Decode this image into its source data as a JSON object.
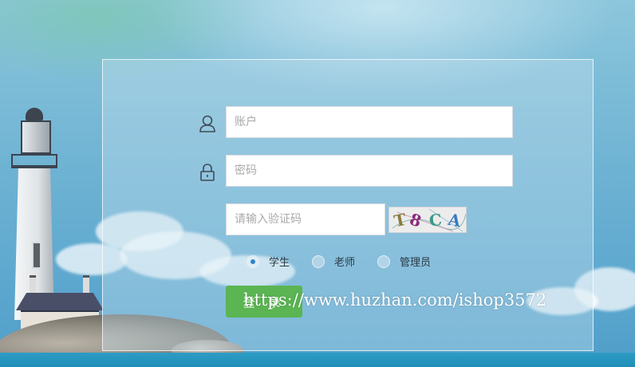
{
  "form": {
    "username": {
      "placeholder": "账户",
      "icon": "user-icon"
    },
    "password": {
      "placeholder": "密码",
      "icon": "lock-icon"
    },
    "captcha_input": {
      "placeholder": "请输入验证码"
    },
    "captcha_image": {
      "text": [
        "T",
        "8",
        "C",
        "A"
      ],
      "colors": [
        "#8a7b3a",
        "#8a2a7a",
        "#3a9a8a",
        "#3a7ac0"
      ]
    },
    "roles": [
      {
        "label": "学生",
        "selected": true
      },
      {
        "label": "老师",
        "selected": false
      },
      {
        "label": "管理员",
        "selected": false
      }
    ],
    "login_label": "登 录"
  },
  "watermark": "https://www.huzhan.com/ishop3572",
  "colors": {
    "accent": "#5ab552",
    "radio_selected": "#2f86c9"
  }
}
